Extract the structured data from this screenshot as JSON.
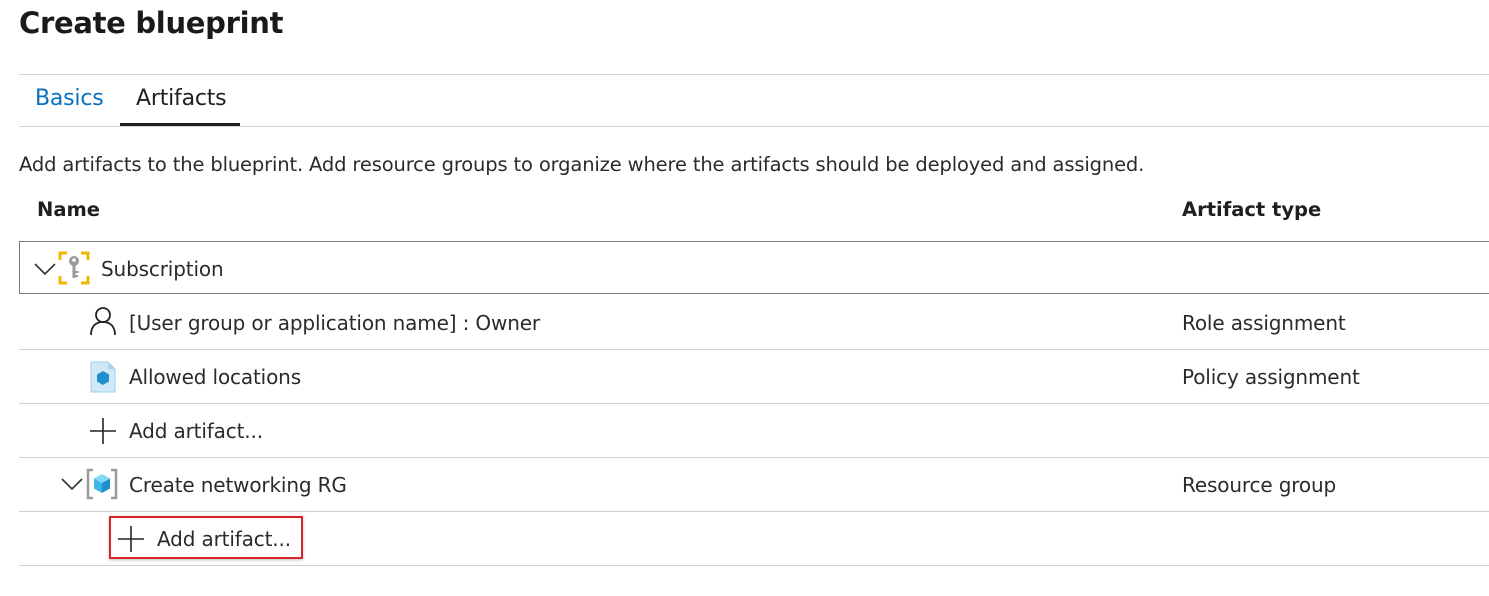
{
  "page": {
    "title": "Create blueprint"
  },
  "tabs": [
    {
      "label": "Basics",
      "active": false
    },
    {
      "label": "Artifacts",
      "active": true
    }
  ],
  "description": "Add artifacts to the blueprint. Add resource groups to organize where the artifacts should be deployed and assigned.",
  "table": {
    "columns": [
      "Name",
      "Artifact type"
    ],
    "rows": [
      {
        "name": "Subscription",
        "type": "",
        "icon": "subscription-key-icon",
        "expanded": true,
        "selected": true
      },
      {
        "name": "[User group or application name] : Owner",
        "type": "Role assignment",
        "icon": "user-icon"
      },
      {
        "name": "Allowed locations",
        "type": "Policy assignment",
        "icon": "policy-icon"
      },
      {
        "name": "Add artifact...",
        "type": "",
        "icon": "plus-icon"
      },
      {
        "name": "Create networking RG",
        "type": "Resource group",
        "icon": "resource-group-icon",
        "expanded": true
      },
      {
        "name": "Add artifact...",
        "type": "",
        "icon": "plus-icon",
        "highlighted": true
      }
    ]
  },
  "colors": {
    "tab_link": "#0a70c0",
    "highlight_border": "#d9232a",
    "subscription_icon": "#f2b705",
    "resource_icon": "#3ab7e8"
  }
}
